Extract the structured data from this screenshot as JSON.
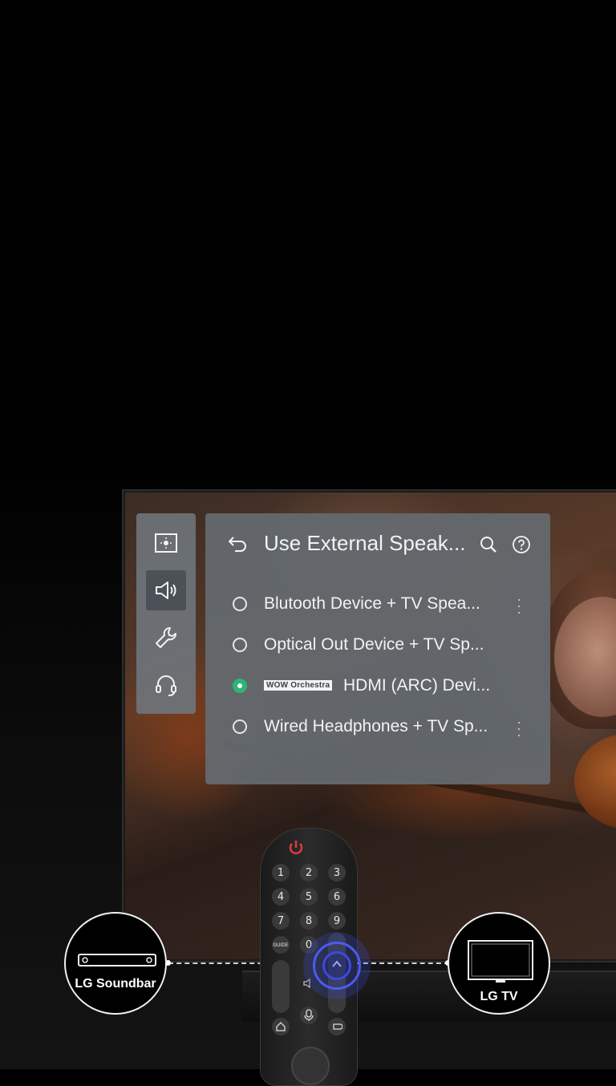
{
  "settings": {
    "title": "Use External Speak...",
    "options": [
      {
        "label": "Blutooth Device + TV Spea...",
        "selected": false,
        "has_more": true
      },
      {
        "label": "Optical Out Device + TV Sp...",
        "selected": false,
        "has_more": false
      },
      {
        "badge": "WOW Orchestra",
        "label": "HDMI (ARC) Devi...",
        "selected": true,
        "has_more": false
      },
      {
        "label": "Wired Headphones + TV Sp...",
        "selected": false,
        "has_more": true
      }
    ]
  },
  "sidebar": {
    "items": [
      {
        "icon": "picture-icon",
        "active": false
      },
      {
        "icon": "speaker-icon",
        "active": true
      },
      {
        "icon": "wrench-icon",
        "active": false
      },
      {
        "icon": "headset-icon",
        "active": false
      }
    ]
  },
  "connection": {
    "left_label": "LG Soundbar",
    "right_label": "LG TV"
  },
  "remote": {
    "keys": [
      "1",
      "2",
      "3",
      "4",
      "5",
      "6",
      "7",
      "8",
      "9",
      "0"
    ],
    "guide_label": "GUIDE"
  },
  "colors": {
    "selected_radio": "#2bb673",
    "panel": "#646a70",
    "highlight_ring": "#3b4bd8"
  }
}
